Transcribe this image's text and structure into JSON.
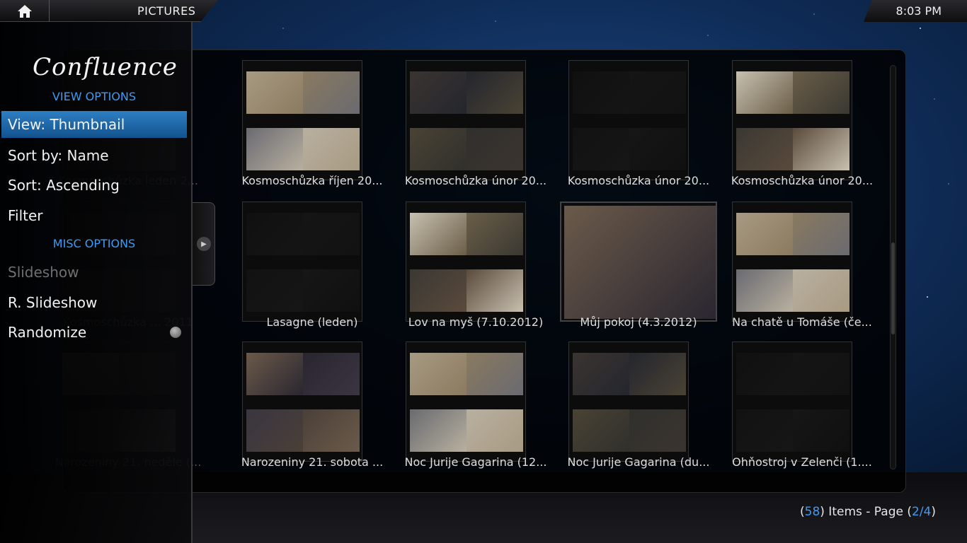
{
  "header": {
    "window_title": "PICTURES",
    "clock": "8:03 PM",
    "home_icon": "home-icon"
  },
  "sidemenu": {
    "logo": "Confluence",
    "view_options_title": "VIEW OPTIONS",
    "items": [
      {
        "label": "View: Thumbnail",
        "selected": true
      },
      {
        "label": "Sort by: Name"
      },
      {
        "label": "Sort: Ascending"
      },
      {
        "label": "Filter"
      }
    ],
    "misc_options_title": "MISC OPTIONS",
    "misc_items": [
      {
        "label": "Slideshow",
        "disabled": true
      },
      {
        "label": "R. Slideshow"
      },
      {
        "label": "Randomize"
      }
    ]
  },
  "grid": {
    "items": [
      {
        "label": "Kosmoschůzka leden 2..."
      },
      {
        "label": "Kosmoschůzka říjen 20..."
      },
      {
        "label": "Kosmoschůzka únor 20..."
      },
      {
        "label": "Kosmoschůzka únor 20..."
      },
      {
        "label": "Kosmoschůzka únor 20..."
      },
      {
        "label": "Kosmoschůzka ... 2011"
      },
      {
        "label": "Lasagne (leden)"
      },
      {
        "label": "Lov na myš (7.10.2012)"
      },
      {
        "label": "Můj pokoj (4.3.2012)"
      },
      {
        "label": "Na chatě u Tomáše (če..."
      },
      {
        "label": "Narozeniny 21. neděle (..."
      },
      {
        "label": "Narozeniny 21. sobota ..."
      },
      {
        "label": "Noc Jurije Gagarina (12..."
      },
      {
        "label": "Noc Jurije Gagarina (du..."
      },
      {
        "label": "Ohňostroj v Zelenči (1...."
      }
    ]
  },
  "footer": {
    "open_paren": "(",
    "count": "58",
    "items_text": ") Items - Page (",
    "page": "2/4",
    "close_paren": ")"
  },
  "colors": {
    "accent": "#3d9bf5",
    "selection": "#1d6aab"
  }
}
